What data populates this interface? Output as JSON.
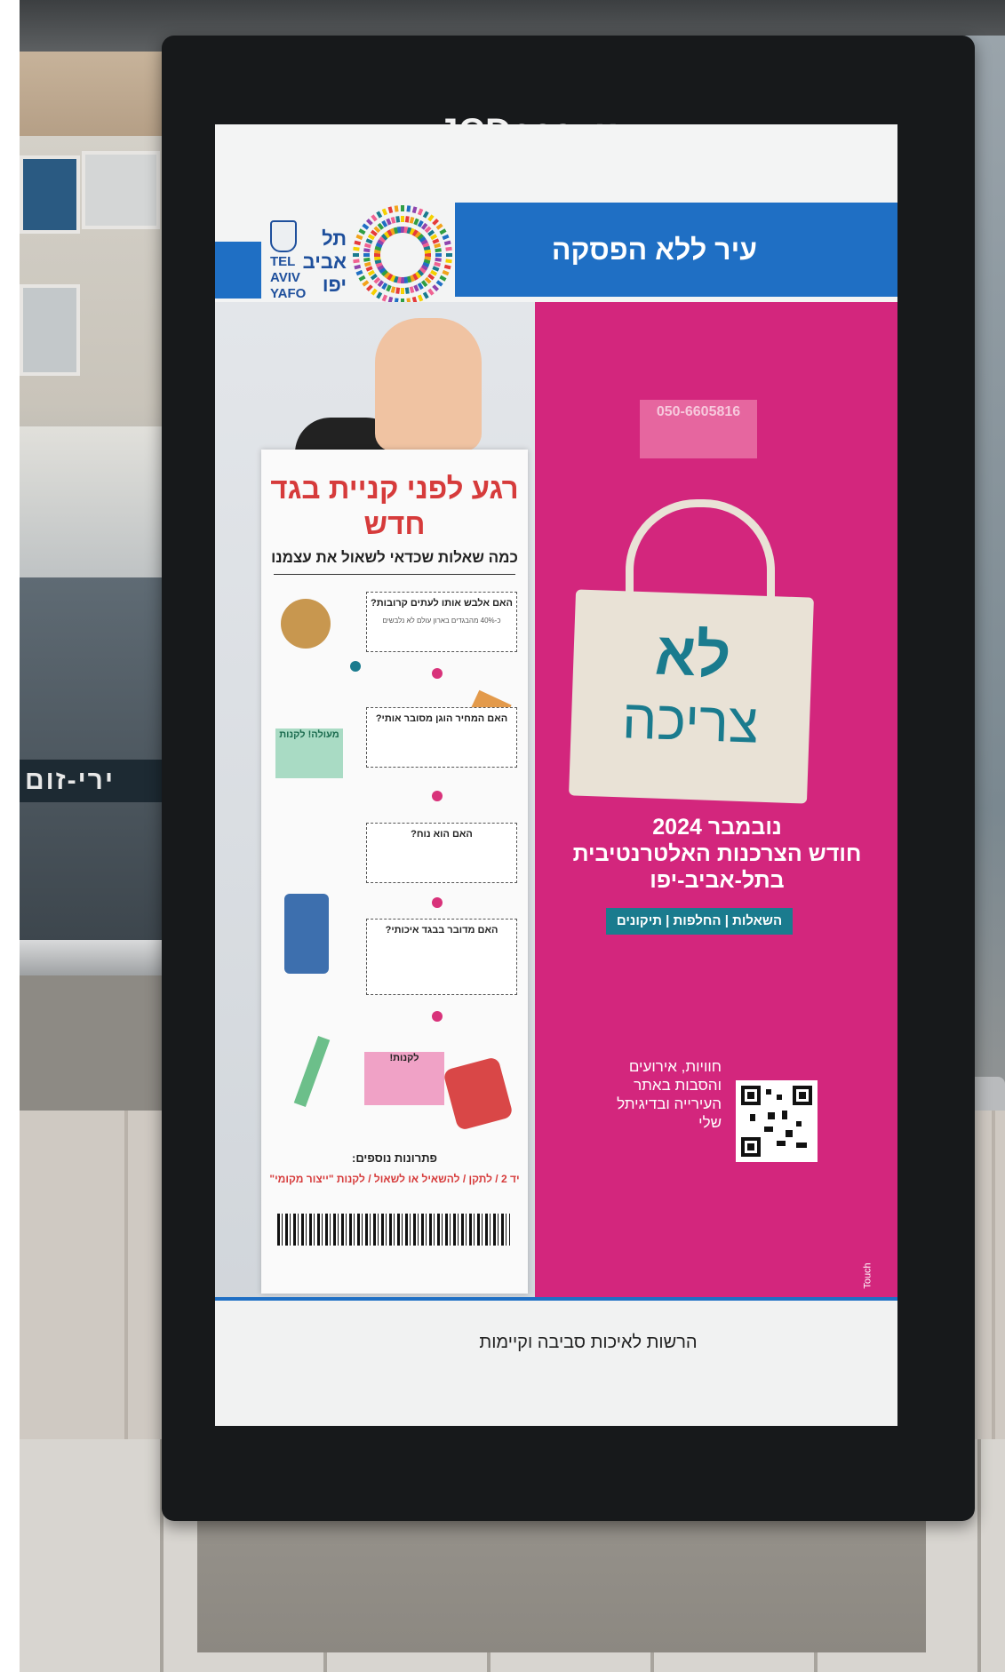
{
  "kiosk": {
    "brand": "JCDecaux"
  },
  "street": {
    "sign_text": "ירי-זום"
  },
  "poster": {
    "logo": {
      "he": "תל אביב יפו",
      "en_line1": "TEL AVIV",
      "en_line2": "YAFO"
    },
    "slogan": "עיר ללא הפסקה",
    "sheet": {
      "title": "רגע לפני קניית בגד חדש",
      "subtitle": "כמה שאלות שכדאי לשאול את עצמנו",
      "questions": [
        {
          "title": "האם אלבש אותו לעתים קרובות?",
          "text": "כ-40% מהבגדים בארון עולם לא נלבשים"
        },
        {
          "title": "האם המחיר הוגן מסובר אותי?",
          "text": ""
        },
        {
          "title": "האם הוא נוח?",
          "text": ""
        },
        {
          "title": "האם מדובר בבגד איכותי?",
          "text": ""
        }
      ],
      "tip_green": "מעולה! לקנות",
      "tip_pink": "לקנות!",
      "footer_title": "פתרונות נוספים:",
      "footer_red": "יד 2 / לתקן / להשאיל או לשאול / לקנות \"ייצור מקומי\""
    },
    "phone_tag": "050-6605816",
    "bag": {
      "line1": "לא",
      "line2": "צריכה"
    },
    "campaign": {
      "date": "נובמבר 2024",
      "line1": "חודש הצרכנות האלטרנטיבית",
      "line2": "בתל-אביב-יפו",
      "tags": "השאלות | החלפות | תיקונים",
      "info": "חוויות, אירועים והסבות באתר העירייה ובדיגיתל שלי"
    },
    "authority": "הרשות לאיכות סביבה וקיימות",
    "printer": "Touch",
    "colors": {
      "pink": "#d3267d",
      "blue": "#1f6fc4",
      "teal": "#1a7b8e",
      "red": "#d63b3b"
    }
  }
}
